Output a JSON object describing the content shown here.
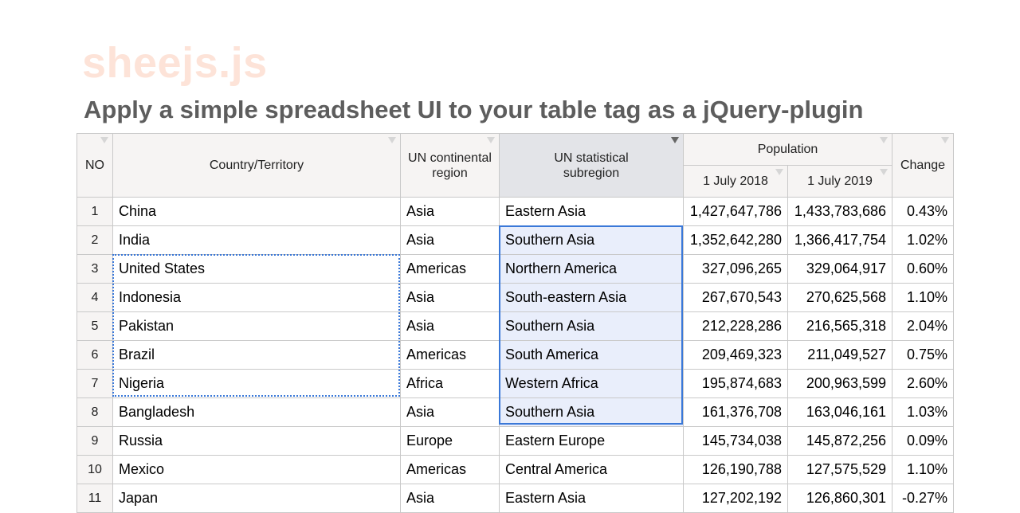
{
  "brand": "sheejs.js",
  "heading": "Apply a simple spreadsheet UI to your table tag as a jQuery-plugin",
  "table": {
    "headers": {
      "no": "NO",
      "country": "Country/Territory",
      "continent": "UN continental region",
      "subregion": "UN statistical subregion",
      "population": "Population",
      "y2018": "1 July 2018",
      "y2019": "1 July 2019",
      "change": "Change"
    },
    "rows": [
      {
        "no": "1",
        "country": "China",
        "continent": "Asia",
        "subregion": "Eastern Asia",
        "y2018": "1,427,647,786",
        "y2019": "1,433,783,686",
        "change": "0.43%"
      },
      {
        "no": "2",
        "country": "India",
        "continent": "Asia",
        "subregion": "Southern Asia",
        "y2018": "1,352,642,280",
        "y2019": "1,366,417,754",
        "change": "1.02%"
      },
      {
        "no": "3",
        "country": "United States",
        "continent": "Americas",
        "subregion": "Northern America",
        "y2018": "327,096,265",
        "y2019": "329,064,917",
        "change": "0.60%"
      },
      {
        "no": "4",
        "country": "Indonesia",
        "continent": "Asia",
        "subregion": "South-eastern Asia",
        "y2018": "267,670,543",
        "y2019": "270,625,568",
        "change": "1.10%"
      },
      {
        "no": "5",
        "country": "Pakistan",
        "continent": "Asia",
        "subregion": "Southern Asia",
        "y2018": "212,228,286",
        "y2019": "216,565,318",
        "change": "2.04%"
      },
      {
        "no": "6",
        "country": "Brazil",
        "continent": "Americas",
        "subregion": "South America",
        "y2018": "209,469,323",
        "y2019": "211,049,527",
        "change": "0.75%"
      },
      {
        "no": "7",
        "country": "Nigeria",
        "continent": "Africa",
        "subregion": "Western Africa",
        "y2018": "195,874,683",
        "y2019": "200,963,599",
        "change": "2.60%"
      },
      {
        "no": "8",
        "country": "Bangladesh",
        "continent": "Asia",
        "subregion": "Southern Asia",
        "y2018": "161,376,708",
        "y2019": "163,046,161",
        "change": "1.03%"
      },
      {
        "no": "9",
        "country": "Russia",
        "continent": "Europe",
        "subregion": "Eastern Europe",
        "y2018": "145,734,038",
        "y2019": "145,872,256",
        "change": "0.09%"
      },
      {
        "no": "10",
        "country": "Mexico",
        "continent": "Americas",
        "subregion": "Central America",
        "y2018": "126,190,788",
        "y2019": "127,575,529",
        "change": "1.10%"
      },
      {
        "no": "11",
        "country": "Japan",
        "continent": "Asia",
        "subregion": "Eastern Asia",
        "y2018": "127,202,192",
        "y2019": "126,860,301",
        "change": "-0.27%"
      }
    ]
  },
  "colors": {
    "brand": "#fde3d8",
    "heading": "#5d5d5d",
    "header_bg": "#f6f4f3",
    "active_header_bg": "#e3e4e8",
    "selection_fill": "#e9eefb",
    "selection_border": "#3a78d8",
    "grid": "#c9c9c9"
  },
  "icons": {
    "filter": "filter-arrow-icon"
  }
}
